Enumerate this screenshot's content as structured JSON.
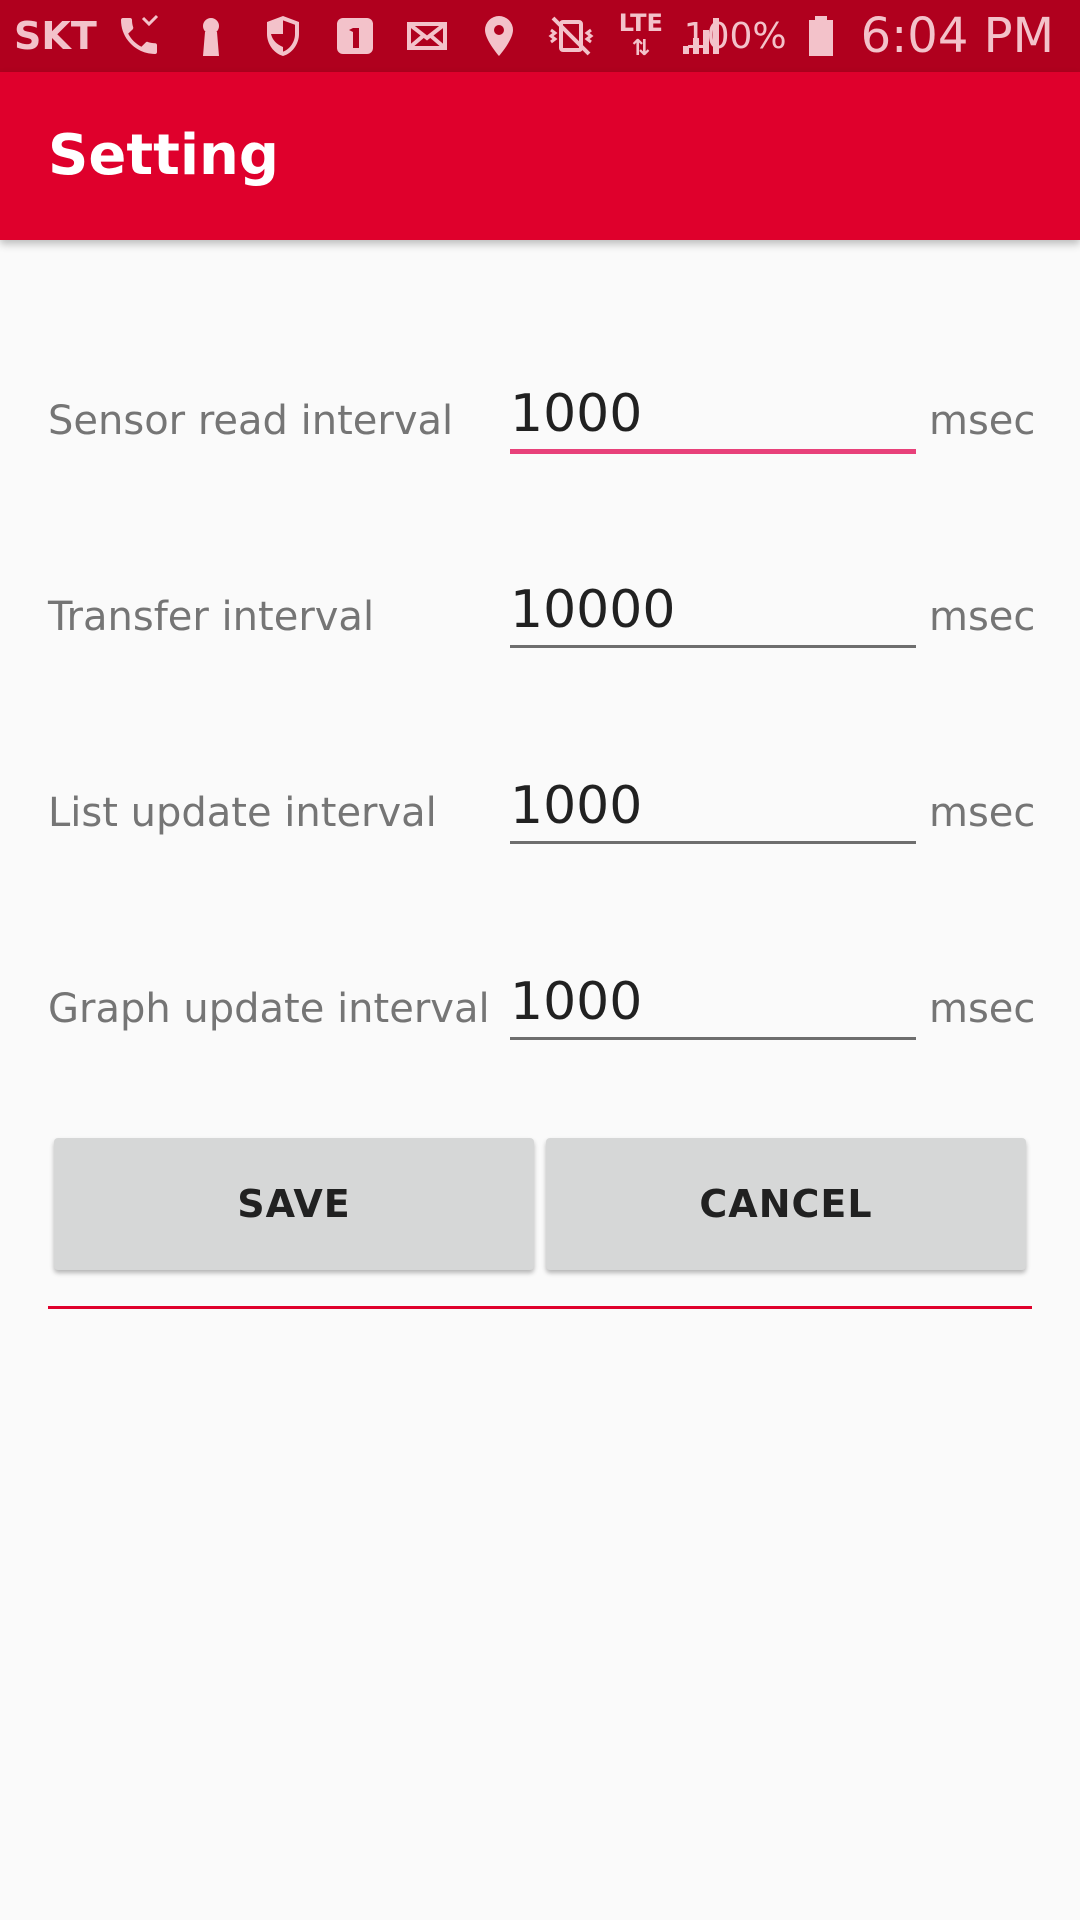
{
  "status_bar": {
    "carrier": "SKT",
    "network": "LTE",
    "battery_percent": "100%",
    "time": "6:04 PM",
    "icons": [
      "phone-missed-icon",
      "keyhole-icon",
      "shield-icon",
      "notification-badge-icon",
      "mail-icon",
      "location-pin-icon",
      "vibrate-off-icon",
      "lte-icon",
      "signal-icon",
      "battery-icon"
    ],
    "background_color": "#b0001e"
  },
  "app_bar": {
    "title": "Setting",
    "background_color": "#df002c"
  },
  "settings": [
    {
      "label": "Sensor read interval",
      "value": "1000",
      "unit": "msec"
    },
    {
      "label": "Transfer interval",
      "value": "10000",
      "unit": "msec"
    },
    {
      "label": "List update interval",
      "value": "1000",
      "unit": "msec"
    },
    {
      "label": "Graph update interval",
      "value": "1000",
      "unit": "msec"
    }
  ],
  "buttons": {
    "save_label": "SAVE",
    "cancel_label": "CANCEL"
  },
  "colors": {
    "focus_underline": "#e8417a",
    "divider": "#df002c"
  }
}
